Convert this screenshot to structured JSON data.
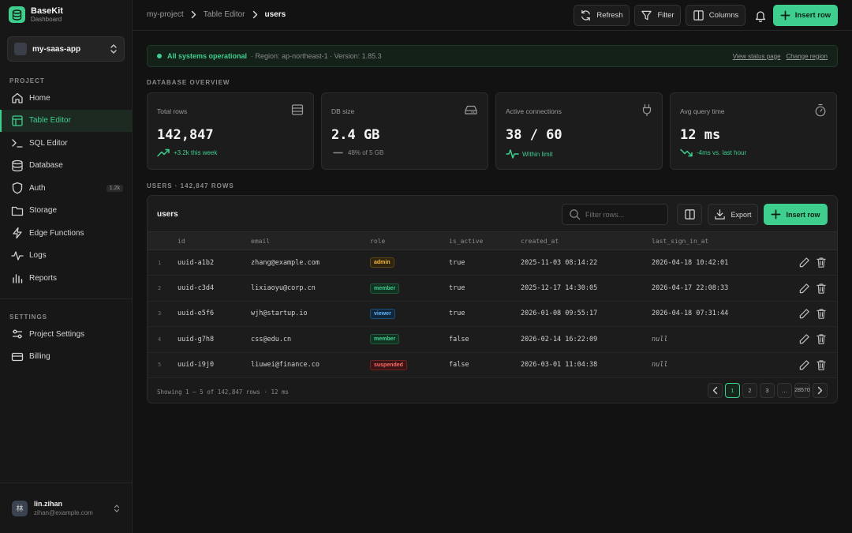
{
  "brand": {
    "name": "BaseKit",
    "sub": "Dashboard"
  },
  "project": {
    "name": "my-saas-app"
  },
  "sidebar": {
    "project_label": "PROJECT",
    "items": [
      {
        "label": "Home",
        "icon": "home-icon"
      },
      {
        "label": "Table Editor",
        "icon": "table-icon",
        "active": true
      },
      {
        "label": "SQL Editor",
        "icon": "terminal-icon"
      },
      {
        "label": "Database",
        "icon": "database-icon"
      },
      {
        "label": "Auth",
        "icon": "shield-icon",
        "badge": "1.2k"
      },
      {
        "label": "Storage",
        "icon": "folder-icon"
      },
      {
        "label": "Edge Functions",
        "icon": "lightning-icon"
      },
      {
        "label": "Logs",
        "icon": "activity-icon"
      },
      {
        "label": "Reports",
        "icon": "bar-chart-icon"
      }
    ],
    "settings_label": "SETTINGS",
    "settings_items": [
      {
        "label": "Project Settings",
        "icon": "sliders-icon"
      },
      {
        "label": "Billing",
        "icon": "credit-card-icon"
      }
    ]
  },
  "user": {
    "initial": "林",
    "name": "lin.zihan",
    "email": "zihan@example.com"
  },
  "breadcrumb": {
    "project": "my-project",
    "section": "Table Editor",
    "current": "users"
  },
  "toolbar": {
    "refresh": "Refresh",
    "filter": "Filter",
    "columns": "Columns",
    "insert": "Insert row"
  },
  "status": {
    "text": "All systems operational",
    "meta": "· Region: ap-northeast-1 · Version: 1.85.3",
    "link_status": "View status page",
    "link_region": "Change region"
  },
  "overview": {
    "heading": "DATABASE OVERVIEW",
    "cards": [
      {
        "label": "Total rows",
        "value": "142,847",
        "sub": "+3.2k this week",
        "icon": "table-rows-icon"
      },
      {
        "label": "DB size",
        "value": "2.4 GB",
        "sub": "48% of 5 GB",
        "icon": "hard-drive-icon"
      },
      {
        "label": "Active connections",
        "value": "38 / 60",
        "sub": "Within limit",
        "icon": "plug-icon"
      },
      {
        "label": "Avg query time",
        "value": "12 ms",
        "sub": "-4ms vs. last hour",
        "icon": "stopwatch-icon"
      }
    ]
  },
  "table_section": {
    "heading": "USERS · 142,847 ROWS",
    "title": "users",
    "search_placeholder": "Filter rows...",
    "export": "Export",
    "insert": "Insert row",
    "columns": [
      "id",
      "email",
      "role",
      "is_active",
      "created_at",
      "last_sign_in_at"
    ],
    "rows": [
      {
        "n": "1",
        "id": "uuid-a1b2",
        "email": "zhang@example.com",
        "role": "admin",
        "is_active": "true",
        "created_at": "2025-11-03 08:14:22",
        "last_sign_in_at": "2026-04-18 10:42:01"
      },
      {
        "n": "2",
        "id": "uuid-c3d4",
        "email": "lixiaoyu@corp.cn",
        "role": "member",
        "is_active": "true",
        "created_at": "2025-12-17 14:30:05",
        "last_sign_in_at": "2026-04-17 22:08:33"
      },
      {
        "n": "3",
        "id": "uuid-e5f6",
        "email": "wjh@startup.io",
        "role": "viewer",
        "is_active": "true",
        "created_at": "2026-01-08 09:55:17",
        "last_sign_in_at": "2026-04-18 07:31:44"
      },
      {
        "n": "4",
        "id": "uuid-g7h8",
        "email": "css@edu.cn",
        "role": "member",
        "is_active": "false",
        "created_at": "2026-02-14 16:22:09",
        "last_sign_in_at": "null"
      },
      {
        "n": "5",
        "id": "uuid-i9j0",
        "email": "liuwei@finance.co",
        "role": "suspended",
        "is_active": "false",
        "created_at": "2026-03-01 11:04:38",
        "last_sign_in_at": "null"
      }
    ],
    "footer": "Showing 1 – 5 of 142,847 rows · 12 ms",
    "pages": [
      "1",
      "2",
      "3",
      "…",
      "28570"
    ],
    "current_page": "1"
  },
  "colors": {
    "accent": "#3ecf8e",
    "admin": "#f5b940",
    "viewer": "#5fb3ff",
    "danger": "#ff6b6b"
  }
}
